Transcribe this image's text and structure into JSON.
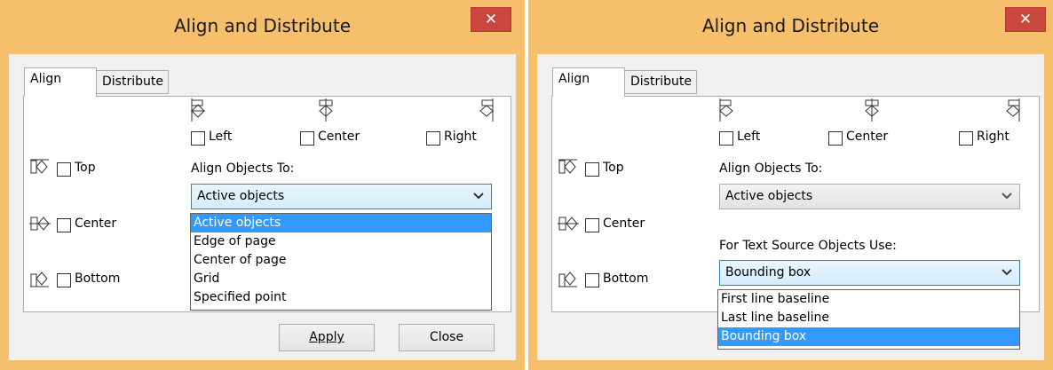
{
  "left_dialog": {
    "title": "Align and Distribute",
    "close_glyph": "✕",
    "tabs": [
      {
        "label": "Align",
        "active": true
      },
      {
        "label": "Distribute",
        "active": false
      }
    ],
    "horizontal": [
      {
        "label": "Left",
        "mnemonic": "L",
        "icon": "align-left-icon"
      },
      {
        "label": "Center",
        "mnemonic": "C",
        "icon": "align-center-horizontal-icon"
      },
      {
        "label": "Right",
        "mnemonic": "R",
        "icon": "align-right-icon"
      }
    ],
    "vertical": [
      {
        "label": "Top",
        "mnemonic": "T",
        "icon": "align-top-icon"
      },
      {
        "label": "Center",
        "mnemonic": "e",
        "icon": "align-center-vertical-icon"
      },
      {
        "label": "Bottom",
        "mnemonic": "B",
        "icon": "align-bottom-icon"
      }
    ],
    "align_to_label": "Align Objects To:",
    "align_to_value": "Active objects",
    "align_to_options": [
      "Active objects",
      "Edge of page",
      "Center of page",
      "Grid",
      "Specified point"
    ],
    "align_to_selected_index": 0,
    "apply_label": "Apply",
    "close_label": "Close"
  },
  "right_dialog": {
    "title": "Align and Distribute",
    "close_glyph": "✕",
    "tabs": [
      {
        "label": "Align",
        "active": true
      },
      {
        "label": "Distribute",
        "active": false
      }
    ],
    "horizontal": [
      {
        "label": "Left"
      },
      {
        "label": "Center"
      },
      {
        "label": "Right"
      }
    ],
    "vertical": [
      {
        "label": "Top"
      },
      {
        "label": "Center"
      },
      {
        "label": "Bottom"
      }
    ],
    "align_to_label": "Align Objects To:",
    "align_to_value": "Active objects",
    "text_source_label": "For Text Source Objects Use:",
    "text_source_value": "Bounding box",
    "text_source_options": [
      "First line baseline",
      "Last line baseline",
      "Bounding box"
    ],
    "text_source_selected_index": 2
  },
  "colors": {
    "frame": "#f6bf6c",
    "close_button": "#c9473d",
    "selection": "#3399ff"
  }
}
